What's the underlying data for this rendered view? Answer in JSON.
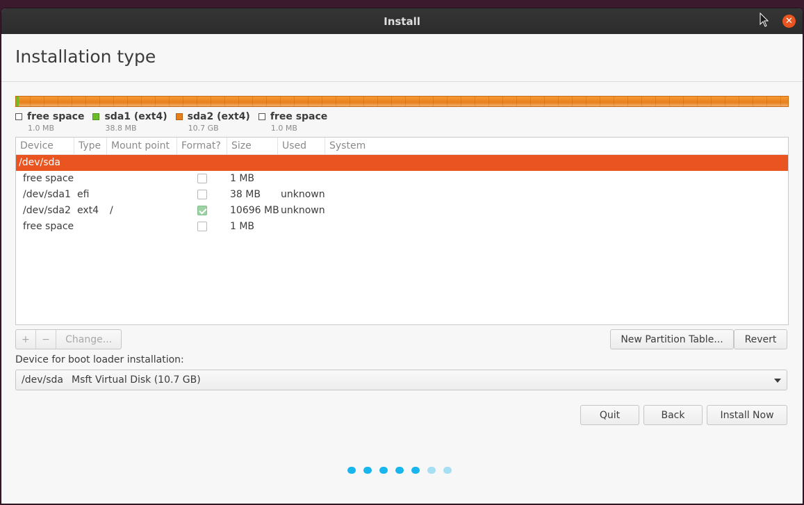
{
  "window": {
    "title": "Install"
  },
  "page": {
    "title": "Installation type"
  },
  "disk_legend": [
    {
      "label": "free space",
      "size": "1.0 MB",
      "color": "#ffffff"
    },
    {
      "label": "sda1 (ext4)",
      "size": "38.8 MB",
      "color": "#6bbd2a"
    },
    {
      "label": "sda2 (ext4)",
      "size": "10.7 GB",
      "color": "#e7801b"
    },
    {
      "label": "free space",
      "size": "1.0 MB",
      "color": "#ffffff"
    }
  ],
  "table": {
    "headers": [
      "Device",
      "Type",
      "Mount point",
      "Format?",
      "Size",
      "Used",
      "System"
    ],
    "disk_row": "/dev/sda",
    "rows": [
      {
        "device": "free space",
        "type": "",
        "mount": "",
        "format": false,
        "size": "1 MB",
        "used": ""
      },
      {
        "device": "/dev/sda1",
        "type": "efi",
        "mount": "",
        "format": false,
        "size": "38 MB",
        "used": "unknown"
      },
      {
        "device": "/dev/sda2",
        "type": "ext4",
        "mount": "/",
        "format": true,
        "size": "10696 MB",
        "used": "unknown"
      },
      {
        "device": "free space",
        "type": "",
        "mount": "",
        "format": false,
        "size": "1 MB",
        "used": ""
      }
    ]
  },
  "toolbar": {
    "add_label": "+",
    "remove_label": "−",
    "change_label": "Change...",
    "new_table_label": "New Partition Table...",
    "revert_label": "Revert"
  },
  "bootloader": {
    "label": "Device for boot loader installation:",
    "device": "/dev/sda",
    "description": "Msft Virtual Disk (10.7 GB)"
  },
  "actions": {
    "quit": "Quit",
    "back": "Back",
    "install": "Install Now"
  },
  "progress": {
    "total_steps": 7,
    "completed_steps": 5
  },
  "colors": {
    "accent": "#e95420",
    "progress": "#19b6ee"
  }
}
